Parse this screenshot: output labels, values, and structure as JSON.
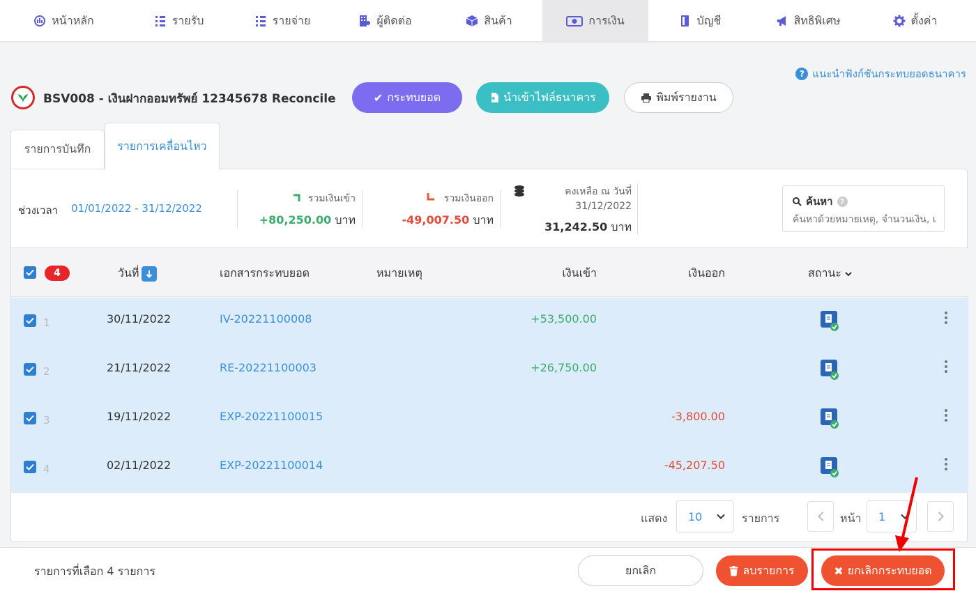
{
  "nav": {
    "items": [
      {
        "label": "หน้าหลัก",
        "icon": "dashboard-gauge-icon"
      },
      {
        "label": "รายรับ",
        "icon": "income-list-icon"
      },
      {
        "label": "รายจ่าย",
        "icon": "expense-list-icon"
      },
      {
        "label": "ผู้ติดต่อ",
        "icon": "contacts-building-icon"
      },
      {
        "label": "สินค้า",
        "icon": "product-box-icon"
      },
      {
        "label": "การเงิน",
        "icon": "finance-money-icon",
        "active": true
      },
      {
        "label": "บัญชี",
        "icon": "accounting-book-icon"
      },
      {
        "label": "สิทธิพิเศษ",
        "icon": "privilege-megaphone-icon"
      },
      {
        "label": "ตั้งค่า",
        "icon": "settings-gear-icon"
      }
    ]
  },
  "header": {
    "help_link": "แนะนำฟังก์ชันกระทบยอดธนาคาร",
    "account_title": "BSV008 - เงินฝากออมทรัพย์ 12345678 Reconcile",
    "reconcile_button": "กระทบยอด",
    "import_button": "นำเข้าไฟล์ธนาคาร",
    "print_button": "พิมพ์รายงาน"
  },
  "tabs": {
    "records": "รายการบันทึก",
    "movements": "รายการเคลื่อนไหว"
  },
  "summary": {
    "period_label": "ช่วงเวลา",
    "period_value": "01/01/2022 - 31/12/2022",
    "total_in_label": "รวมเงินเข้า",
    "total_in_value": "+80,250.00",
    "total_out_label": "รวมเงินออก",
    "total_out_value": "-49,007.50",
    "balance_label_1": "คงเหลือ ณ วันที่",
    "balance_label_2": "31/12/2022",
    "balance_value": "31,242.50",
    "currency": "บาท"
  },
  "search": {
    "title": "ค้นหา",
    "placeholder": "ค้นหาด้วยหมายเหตุ, จำนวนเงิน, เ"
  },
  "table": {
    "selected_count": "4",
    "headers": {
      "date": "วันที่",
      "document": "เอกสารกระทบยอด",
      "note": "หมายเหตุ",
      "money_in": "เงินเข้า",
      "money_out": "เงินออก",
      "status": "สถานะ"
    },
    "rows": [
      {
        "num": "1",
        "date": "30/11/2022",
        "doc": "IV-20221100008",
        "in": "+53,500.00",
        "out": ""
      },
      {
        "num": "2",
        "date": "21/11/2022",
        "doc": "RE-20221100003",
        "in": "+26,750.00",
        "out": ""
      },
      {
        "num": "3",
        "date": "19/11/2022",
        "doc": "EXP-20221100015",
        "in": "",
        "out": "-3,800.00"
      },
      {
        "num": "4",
        "date": "02/11/2022",
        "doc": "EXP-20221100014",
        "in": "",
        "out": "-45,207.50"
      }
    ]
  },
  "pagination": {
    "show_label": "แสดง",
    "per_page": "10",
    "items_label": "รายการ",
    "page_label": "หน้า",
    "page": "1"
  },
  "bottom": {
    "selected_text": "รายการที่เลือก 4 รายการ",
    "cancel_button": "ยกเลิก",
    "delete_button": "ลบรายการ",
    "unreconcile_button": "ยกเลิกกระทบยอด"
  },
  "colors": {
    "primary": "#7c6cf0",
    "teal": "#3cbfc4",
    "link": "#3a8fd8",
    "danger": "#ef5230",
    "income": "#3cab6e",
    "expense": "#e04b3b"
  }
}
